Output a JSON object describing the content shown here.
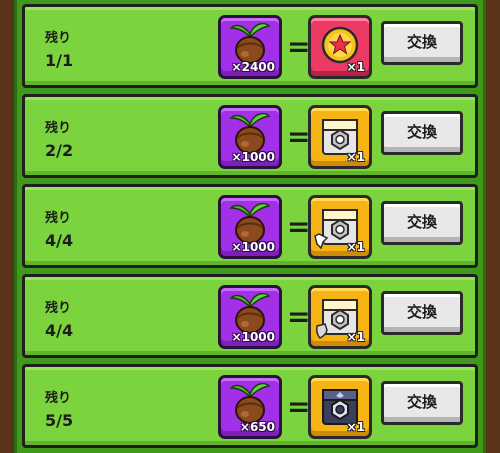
{
  "colors": {
    "row_background": "#7bd33d",
    "cost_background": "#a230e8",
    "reward_red": "#ec3a64",
    "reward_gold": "#f6b414",
    "button_background": "#e8e8e8"
  },
  "equals_sign": "=",
  "exchange_label": "交換",
  "offers": [
    {
      "remaining_label": "残り",
      "remaining": "1/1",
      "cost_icon": "seed-icon",
      "cost_qty": "×2400",
      "reward_icon": "star-medal-icon",
      "reward_qty": "×1"
    },
    {
      "remaining_label": "残り",
      "remaining": "2/2",
      "cost_icon": "seed-icon",
      "cost_qty": "×1000",
      "reward_icon": "gold-chest-icon",
      "reward_qty": "×1"
    },
    {
      "remaining_label": "残り",
      "remaining": "4/4",
      "cost_icon": "seed-icon",
      "cost_qty": "×1000",
      "reward_icon": "gold-chest-arrow-icon",
      "reward_qty": "×1"
    },
    {
      "remaining_label": "残り",
      "remaining": "4/4",
      "cost_icon": "seed-icon",
      "cost_qty": "×1000",
      "reward_icon": "gold-chest-shield-icon",
      "reward_qty": "×1"
    },
    {
      "remaining_label": "残り",
      "remaining": "5/5",
      "cost_icon": "seed-icon",
      "cost_qty": "×650",
      "reward_icon": "dark-chest-icon",
      "reward_qty": "×1"
    }
  ]
}
